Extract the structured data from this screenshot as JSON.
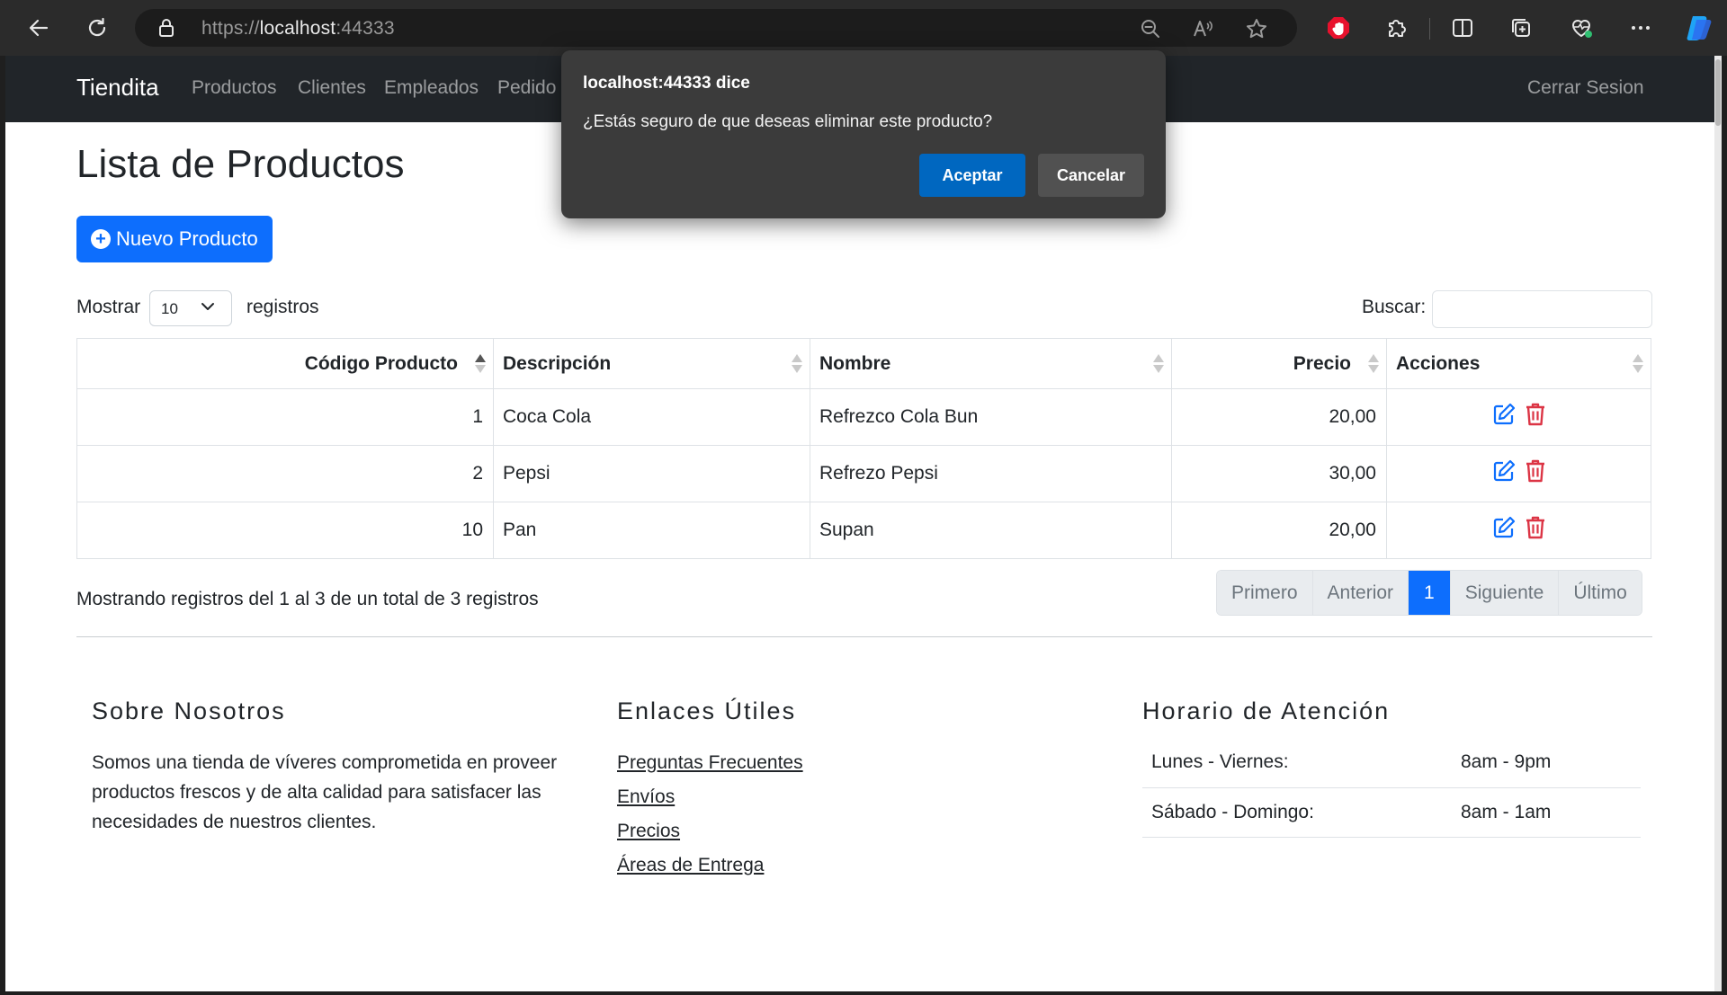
{
  "browser": {
    "url_scheme": "https://",
    "url_host": "localhost",
    "url_port": ":44333"
  },
  "navbar": {
    "brand": "Tiendita",
    "links": [
      "Productos",
      "Clientes",
      "Empleados",
      "Pedido"
    ],
    "logout": "Cerrar Sesion"
  },
  "main": {
    "title": "Lista de Productos",
    "new_button": "Nuevo Producto",
    "length": {
      "prefix": "Mostrar",
      "value": "10",
      "suffix": "registros"
    },
    "search_label": "Buscar:",
    "columns": [
      "Código Producto",
      "Descripción",
      "Nombre",
      "Precio",
      "Acciones"
    ],
    "rows": [
      {
        "codigo": "1",
        "descripcion": "Coca Cola",
        "nombre": "Refrezco Cola Bun",
        "precio": "20,00"
      },
      {
        "codigo": "2",
        "descripcion": "Pepsi",
        "nombre": "Refrezo Pepsi",
        "precio": "30,00"
      },
      {
        "codigo": "10",
        "descripcion": "Pan",
        "nombre": "Supan",
        "precio": "20,00"
      }
    ],
    "info": "Mostrando registros del 1 al 3 de un total de 3 registros",
    "pagination": {
      "first": "Primero",
      "prev": "Anterior",
      "current": "1",
      "next": "Siguiente",
      "last": "Último"
    }
  },
  "footer": {
    "about": {
      "title": "Sobre Nosotros",
      "text": "Somos una tienda de víveres comprometida en proveer productos frescos y de alta calidad para satisfacer las necesidades de nuestros clientes."
    },
    "links": {
      "title": "Enlaces Útiles",
      "items": [
        "Preguntas Frecuentes",
        "Envíos",
        "Precios",
        "Áreas de Entrega"
      ]
    },
    "hours": {
      "title": "Horario de Atención",
      "rows": [
        {
          "days": "Lunes - Viernes:",
          "time": "8am - 9pm"
        },
        {
          "days": "Sábado - Domingo:",
          "time": "8am - 1am"
        }
      ]
    }
  },
  "dialog": {
    "title": "localhost:44333 dice",
    "message": "¿Estás seguro de que deseas eliminar este producto?",
    "ok": "Aceptar",
    "cancel": "Cancelar"
  },
  "icons": {
    "edit": "edit-icon",
    "delete": "trash-icon",
    "plus": "plus-circle-icon"
  },
  "colors": {
    "primary": "#0d6efd",
    "danger": "#dc3545",
    "navbar": "#212529",
    "dialog_bg": "#3b3b3b",
    "dialog_ok": "#0067c0"
  }
}
